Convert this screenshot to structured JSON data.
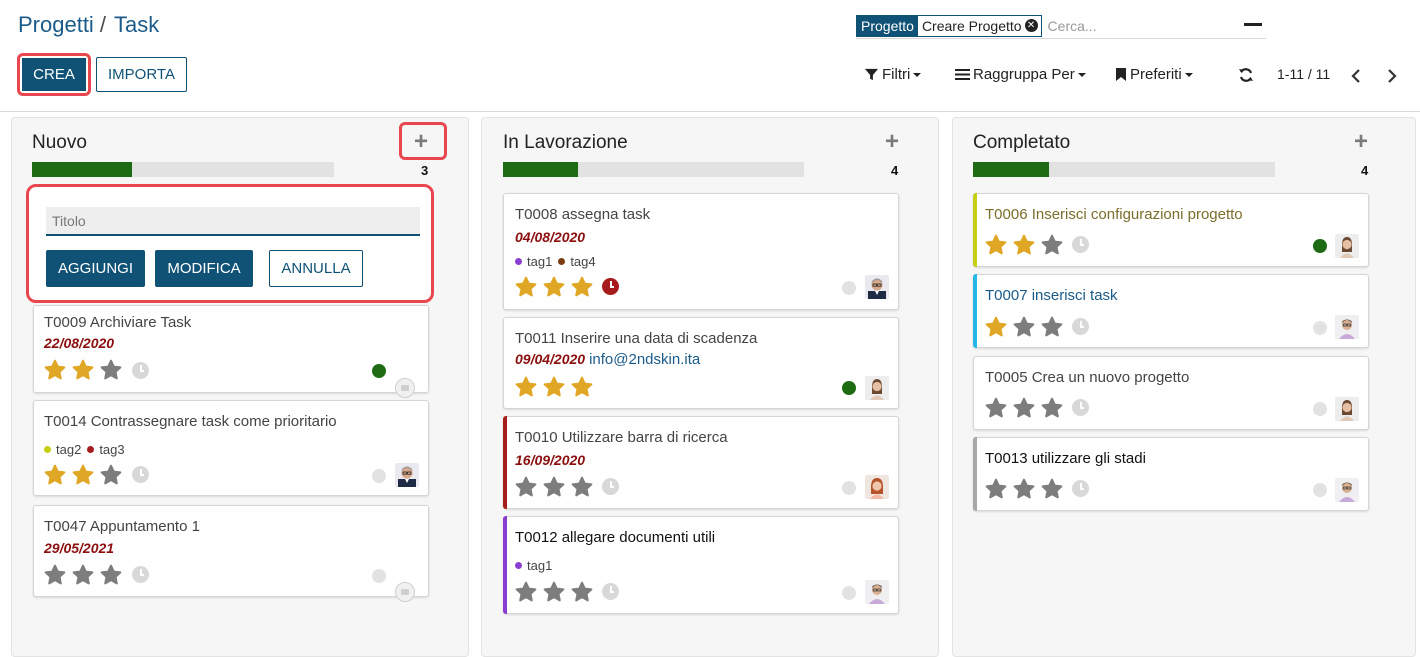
{
  "breadcrumb": {
    "parent": "Progetti",
    "separator": "/",
    "current": "Task"
  },
  "search": {
    "facet_label": "Progetto",
    "facet_value": "Creare Progetto",
    "placeholder": "Cerca..."
  },
  "actions": {
    "create_label": "CREA",
    "import_label": "IMPORTA"
  },
  "toolbar": {
    "filters_label": "Filtri",
    "groupby_label": "Raggruppa Per",
    "favorites_label": "Preferiti",
    "pager": "1-11 / 11"
  },
  "quick_create": {
    "placeholder": "Titolo",
    "add_label": "AGGIUNGI",
    "edit_label": "MODIFICA",
    "cancel_label": "ANNULLA"
  },
  "colors": {
    "primary": "#0f5276",
    "highlight": "#e8474f",
    "progress": "#1d6b12",
    "date": "#8b0f0f",
    "star_on": "#e0a726",
    "star_off": "#7d7d7d"
  },
  "columns": [
    {
      "title": "Nuovo",
      "count": "3",
      "progress": 0.33,
      "cards": [
        {
          "title": "T0009 Archiviare Task",
          "date": "22/08/2020",
          "stars": 2,
          "status": "green",
          "assignee": "placeholder"
        },
        {
          "title": "T0014 Contrassegnare task come prioritario",
          "tags": [
            {
              "name": "tag2",
              "color": "#c7cf13"
            },
            {
              "name": "tag3",
              "color": "#a61c1c"
            }
          ],
          "stars": 2,
          "status": "grey",
          "assignee": "man-glasses"
        },
        {
          "title": "T0047 Appuntamento 1",
          "date": "29/05/2021",
          "stars": 0,
          "status": "grey",
          "assignee": "placeholder"
        }
      ]
    },
    {
      "title": "In Lavorazione",
      "count": "4",
      "progress": 0.25,
      "cards": [
        {
          "title": "T0008 assegna task",
          "date": "04/08/2020",
          "tags": [
            {
              "name": "tag1",
              "color": "#8b3fd1"
            },
            {
              "name": "tag4",
              "color": "#7a3b12"
            }
          ],
          "stars": 3,
          "overdue": true,
          "status": "grey",
          "assignee": "man-glasses"
        },
        {
          "title": "T0011 Inserire una data di scadenza",
          "date": "09/04/2020",
          "email": "info@2ndskin.ita",
          "stars": 3,
          "status": "green",
          "assignee": "woman"
        },
        {
          "title": "T0010 Utilizzare barra di ricerca",
          "date": "16/09/2020",
          "stars": 0,
          "status": "grey",
          "assignee": "woman-red",
          "accent": "#a61c1c"
        },
        {
          "title": "T0012 allegare documenti utili",
          "tags": [
            {
              "name": "tag1",
              "color": "#8b3fd1"
            }
          ],
          "stars": 0,
          "status": "grey",
          "assignee": "man-casual",
          "accent": "#8b3fd1"
        }
      ]
    },
    {
      "title": "Completato",
      "count": "4",
      "progress": 0.25,
      "cards": [
        {
          "title": "T0006 Inserisci configurazioni progetto",
          "stars": 2,
          "status": "green",
          "assignee": "woman",
          "accent": "#c7cf13"
        },
        {
          "title": "T0007 inserisci task",
          "stars": 1,
          "status": "grey",
          "assignee": "man-casual",
          "accent": "#25b8e6"
        },
        {
          "title": "T0005 Crea un nuovo progetto",
          "stars": 0,
          "status": "grey",
          "assignee": "woman"
        },
        {
          "title": "T0013 utilizzare gli stadi",
          "stars": 0,
          "status": "grey",
          "assignee": "man-casual",
          "accent": "#a8a8a8"
        }
      ]
    }
  ]
}
